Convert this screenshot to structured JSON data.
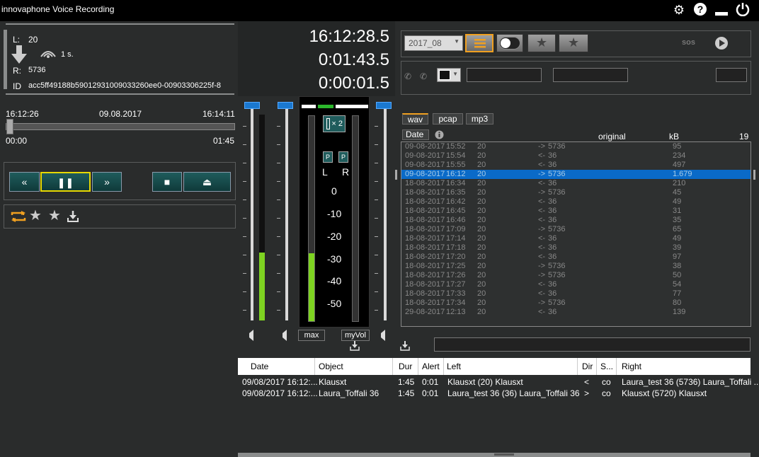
{
  "window": {
    "title": "innovaphone Voice Recording"
  },
  "titlebar": {
    "gear_icon": "gear-icon",
    "help_icon": "help-icon",
    "minimize_icon": "minimize-icon",
    "power_icon": "power-icon"
  },
  "call": {
    "left_label": "L:",
    "left_value": "20",
    "signal_text": "1 s.",
    "right_label": "R:",
    "right_value": "5736",
    "id_label": "ID",
    "id_value": "acc5ff49188b59012931009033260ee0-00903306225f-8"
  },
  "playback": {
    "start_time": "16:12:26",
    "date": "09.08.2017",
    "end_time": "16:14:11",
    "position": "00:00",
    "duration": "01:45",
    "progress": 0.0
  },
  "controls": {
    "rewind": "«",
    "pause": "❚❚",
    "forward": "»",
    "stop": "■",
    "eject": "⏏"
  },
  "clocks": {
    "current": "16:12:28.5",
    "elapsed": "0:01:43.5",
    "segment": "0:00:01.5"
  },
  "meter": {
    "zoom_label": "× 2",
    "p_label": "P",
    "l_label": "L",
    "r_label": "R",
    "scale": [
      "0",
      "-10",
      "-20",
      "-30",
      "-40",
      "-50"
    ],
    "left_level": 0.33,
    "right_level": 0.0,
    "input_level": 0.33,
    "max_label": "max",
    "myvol_label": "myVol"
  },
  "filter": {
    "month_select": "2017_08",
    "sos_label": "sos"
  },
  "format_tabs": [
    "wav",
    "pcap",
    "mp3"
  ],
  "list": {
    "date_header": "Date",
    "original_header": "original",
    "kb_header": "kB",
    "count": "19",
    "rows": [
      {
        "date": "09-08-2017",
        "time": "15:52",
        "num": "20",
        "dir": "->",
        "peer": "5736",
        "kb": "95"
      },
      {
        "date": "09-08-2017",
        "time": "15:54",
        "num": "20",
        "dir": "<-",
        "peer": "36",
        "kb": "234"
      },
      {
        "date": "09-08-2017",
        "time": "15:55",
        "num": "20",
        "dir": "<-",
        "peer": "36",
        "kb": "497"
      },
      {
        "date": "09-08-2017",
        "time": "16:12",
        "num": "20",
        "dir": "->",
        "peer": "5736",
        "kb": "1.679"
      },
      {
        "date": "18-08-2017",
        "time": "16:34",
        "num": "20",
        "dir": "<-",
        "peer": "36",
        "kb": "210"
      },
      {
        "date": "18-08-2017",
        "time": "16:35",
        "num": "20",
        "dir": "->",
        "peer": "5736",
        "kb": "45"
      },
      {
        "date": "18-08-2017",
        "time": "16:42",
        "num": "20",
        "dir": "<-",
        "peer": "36",
        "kb": "49"
      },
      {
        "date": "18-08-2017",
        "time": "16:45",
        "num": "20",
        "dir": "<-",
        "peer": "36",
        "kb": "31"
      },
      {
        "date": "18-08-2017",
        "time": "16:46",
        "num": "20",
        "dir": "<-",
        "peer": "36",
        "kb": "35"
      },
      {
        "date": "18-08-2017",
        "time": "17:09",
        "num": "20",
        "dir": "->",
        "peer": "5736",
        "kb": "65"
      },
      {
        "date": "18-08-2017",
        "time": "17:14",
        "num": "20",
        "dir": "<-",
        "peer": "36",
        "kb": "49"
      },
      {
        "date": "18-08-2017",
        "time": "17:18",
        "num": "20",
        "dir": "<-",
        "peer": "36",
        "kb": "39"
      },
      {
        "date": "18-08-2017",
        "time": "17:20",
        "num": "20",
        "dir": "<-",
        "peer": "36",
        "kb": "97"
      },
      {
        "date": "18-08-2017",
        "time": "17:25",
        "num": "20",
        "dir": "->",
        "peer": "5736",
        "kb": "38"
      },
      {
        "date": "18-08-2017",
        "time": "17:26",
        "num": "20",
        "dir": "->",
        "peer": "5736",
        "kb": "50"
      },
      {
        "date": "18-08-2017",
        "time": "17:27",
        "num": "20",
        "dir": "<-",
        "peer": "36",
        "kb": "54"
      },
      {
        "date": "18-08-2017",
        "time": "17:33",
        "num": "20",
        "dir": "<-",
        "peer": "36",
        "kb": "77"
      },
      {
        "date": "18-08-2017",
        "time": "17:34",
        "num": "20",
        "dir": "->",
        "peer": "5736",
        "kb": "80"
      },
      {
        "date": "29-08-2017",
        "time": "12:13",
        "num": "20",
        "dir": "<-",
        "peer": "36",
        "kb": "139"
      }
    ],
    "selected_index": 3
  },
  "table": {
    "headers": {
      "date": "Date",
      "object": "Object",
      "dur": "Dur",
      "alert": "Alert",
      "left": "Left",
      "dir": "Dir",
      "s": "S...",
      "right": "Right"
    },
    "rows": [
      {
        "date": "09/08/2017 16:12:...",
        "object": "Klausxt",
        "dur": "1:45",
        "alert": "0:01",
        "left": "Klausxt (20) Klausxt",
        "dir": "<",
        "s": "co",
        "right": "Laura_test 36 (5736) Laura_Toffali ..."
      },
      {
        "date": "09/08/2017 16:12:...",
        "object": "Laura_Toffali 36",
        "dur": "1:45",
        "alert": "0:01",
        "left": "Laura_test 36 (36) Laura_Toffali 36",
        "dir": ">",
        "s": "co",
        "right": "Klausxt (5720) Klausxt"
      }
    ]
  }
}
